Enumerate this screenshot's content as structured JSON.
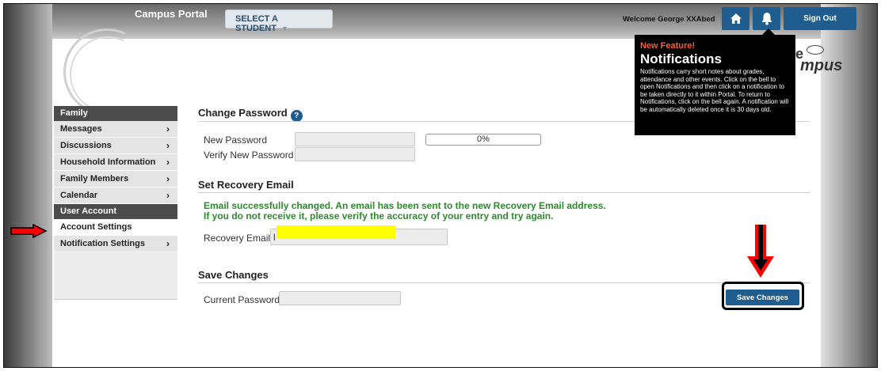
{
  "header": {
    "portal_title": "Campus Portal",
    "student_select_label": "SELECT A STUDENT",
    "welcome_text": "Welcome George XXAbed",
    "signout_label": "Sign Out",
    "brand_text": "mpus"
  },
  "sidebar": {
    "sections": [
      {
        "header": "Family",
        "items": [
          {
            "label": "Messages",
            "has_chevron": true
          },
          {
            "label": "Discussions",
            "has_chevron": true
          },
          {
            "label": "Household Information",
            "has_chevron": true
          },
          {
            "label": "Family Members",
            "has_chevron": true
          },
          {
            "label": "Calendar",
            "has_chevron": true
          }
        ]
      },
      {
        "header": "User Account",
        "items": [
          {
            "label": "Account Settings",
            "has_chevron": false,
            "active": true
          },
          {
            "label": "Notification Settings",
            "has_chevron": true
          }
        ]
      }
    ]
  },
  "change_password": {
    "title": "Change Password",
    "new_password_label": "New Password",
    "verify_label": "Verify New Password",
    "strength": "0%"
  },
  "recovery": {
    "title": "Set Recovery Email",
    "success_line1": "Email successfully changed. An email has been sent to the new Recovery Email address.",
    "success_line2": "If you do not receive it, please verify the accuracy of your entry and try again.",
    "email_label": "Recovery Email",
    "email_value": "l"
  },
  "save": {
    "title": "Save Changes",
    "current_password_label": "Current Password",
    "button_label": "Save Changes"
  },
  "notification_popup": {
    "kicker": "New Feature!",
    "title": "Notifications",
    "body": "Notifications carry short notes about grades, attendance and other events. Click on the bell to open Notifications and then click on a notification to be taken directly to it within Portal. To return to Notifications, click on the bell again. A notification will be automatically deleted once it is 30 days old."
  },
  "colors": {
    "primary": "#1f5d8e",
    "success": "#2f8a2f",
    "annotation_arrow": "#ff0000",
    "highlight": "#ffff00",
    "popup_accent": "#ff5a36"
  }
}
